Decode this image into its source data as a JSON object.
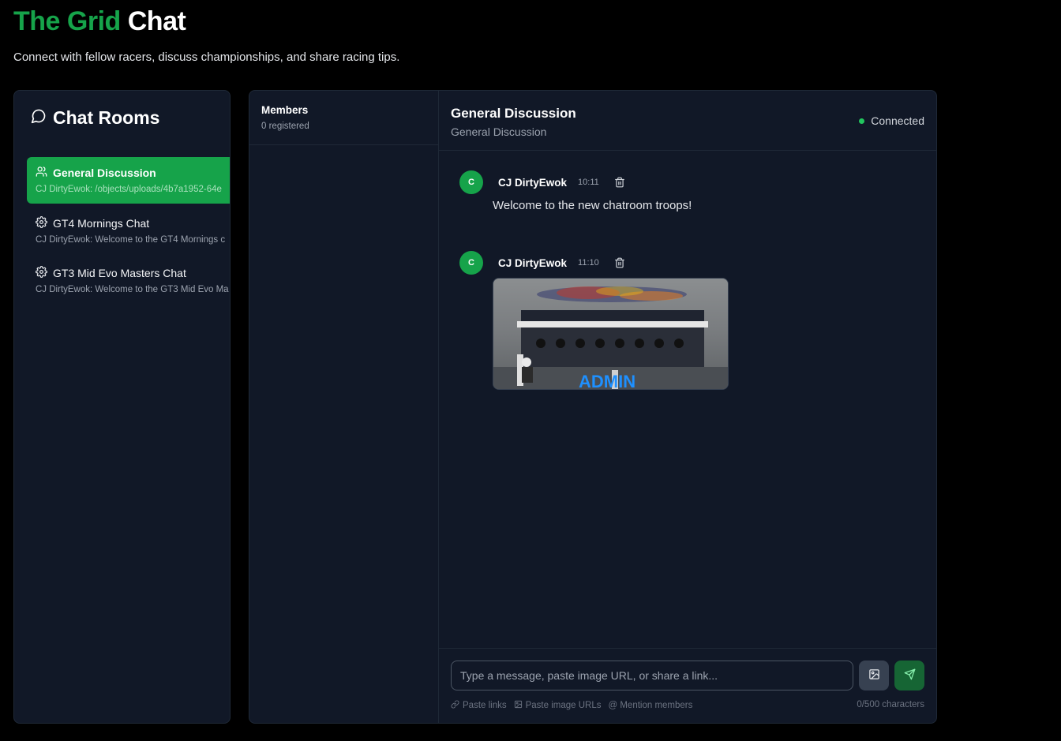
{
  "header": {
    "title_accent": "The Grid",
    "title_rest": "Chat",
    "subtitle": "Connect with fellow racers, discuss championships, and share racing tips."
  },
  "rooms": {
    "title": "Chat Rooms",
    "icon": "message-circle-icon",
    "items": [
      {
        "name": "General Discussion",
        "preview": "CJ DirtyEwok: /objects/uploads/4b7a1952-64e",
        "icon": "users-icon",
        "active": true
      },
      {
        "name": "GT4 Mornings Chat",
        "preview": "CJ DirtyEwok: Welcome to the GT4 Mornings c",
        "icon": "gear-icon",
        "active": false
      },
      {
        "name": "GT3 Mid Evo Masters Chat",
        "preview": "CJ DirtyEwok: Welcome to the GT3 Mid Evo Ma",
        "icon": "gear-icon",
        "active": false
      }
    ]
  },
  "members": {
    "title": "Members",
    "count": "0 registered"
  },
  "chat": {
    "title": "General Discussion",
    "subtitle": "General Discussion",
    "status": "Connected",
    "status_color": "#22c55e",
    "messages": [
      {
        "avatar": "C",
        "author": "CJ DirtyEwok",
        "time": "10:11",
        "text": "Welcome to the new chatroom troops!"
      },
      {
        "avatar": "C",
        "author": "CJ DirtyEwok",
        "time": "11:10",
        "image_text": "ADMIN"
      }
    ]
  },
  "composer": {
    "placeholder": "Type a message, paste image URL, or share a link...",
    "hint_links": "Paste links",
    "hint_images": "Paste image URLs",
    "hint_mentions": "@ Mention members",
    "char_count": "0/500 characters"
  },
  "colors": {
    "accent": "#16a34a",
    "background": "#000000",
    "panel": "#111827"
  }
}
